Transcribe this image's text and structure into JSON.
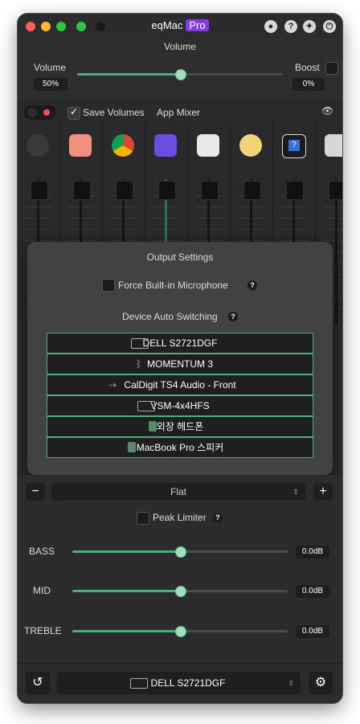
{
  "window": {
    "app_name": "eqMac",
    "badge": "Pro",
    "icons": [
      "user-icon",
      "help-icon",
      "wrench-icon",
      "power-icon"
    ]
  },
  "volume": {
    "title": "Volume",
    "label": "Volume",
    "value_text": "50%",
    "level": 0.5,
    "boost_label": "Boost",
    "boost_value_text": "0%"
  },
  "mixer": {
    "save_volumes_label": "Save Volumes",
    "app_mixer_label": "App Mixer",
    "apps": [
      {
        "name": "speaker-icon"
      },
      {
        "name": "notes-icon"
      },
      {
        "name": "chrome-icon"
      },
      {
        "name": "app-purple-icon"
      },
      {
        "name": "app-white-icon"
      },
      {
        "name": "app-yellow-icon"
      },
      {
        "name": "question-app-icon"
      },
      {
        "name": "app-light-icon"
      }
    ]
  },
  "popup": {
    "title": "Output Settings",
    "force_mic_label": "Force Built-in Microphone",
    "auto_switch_label": "Device Auto Switching",
    "devices": [
      {
        "name": "DELL S2721DGF",
        "icon": "hdmi-icon"
      },
      {
        "name": "MOMENTUM 3",
        "icon": "bluetooth-icon"
      },
      {
        "name": "CalDigit TS4 Audio - Front",
        "icon": "usb-icon"
      },
      {
        "name": "VSM-4x4HFS",
        "icon": "hdmi-icon"
      },
      {
        "name": "외장 헤드폰",
        "icon": "speaker-icon"
      },
      {
        "name": "MacBook Pro 스피커",
        "icon": "speaker-icon"
      }
    ]
  },
  "eq": {
    "preset": "Flat",
    "peak_limiter_label": "Peak Limiter",
    "bands": [
      {
        "label": "BASS",
        "value": "0.0dB",
        "level": 0.5
      },
      {
        "label": "MID",
        "value": "0.0dB",
        "level": 0.5
      },
      {
        "label": "TREBLE",
        "value": "0.0dB",
        "level": 0.5
      }
    ]
  },
  "footer": {
    "output_device": "DELL S2721DGF"
  },
  "colors": {
    "accent": "#4caf77",
    "pro_badge": "#8a3be0",
    "window_bg": "#2c2c2e"
  }
}
